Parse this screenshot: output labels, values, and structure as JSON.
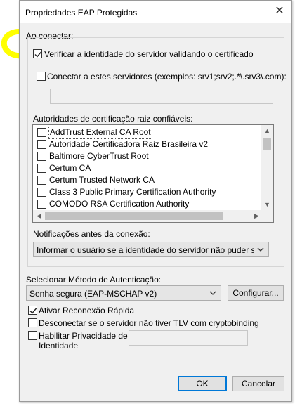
{
  "dialog": {
    "title": "Propriedades EAP Protegidas",
    "close_glyph": "✕"
  },
  "connect_section": {
    "heading": "Ao conectar:",
    "verify_server_label": "Verificar a identidade do servidor validando o certificado",
    "verify_server_checked": true,
    "connect_servers_label": "Conectar a estes servidores (exemplos: srv1;srv2;.*\\.srv3\\.com):",
    "connect_servers_checked": false,
    "servers_value": "",
    "ca_heading": "Autoridades de certificação raiz confiáveis:",
    "ca_items": [
      {
        "label": "AddTrust External CA Root",
        "checked": false
      },
      {
        "label": "Autoridade Certificadora Raiz Brasileira v2",
        "checked": false
      },
      {
        "label": "Baltimore CyberTrust Root",
        "checked": false
      },
      {
        "label": "Certum CA",
        "checked": false
      },
      {
        "label": "Certum Trusted Network CA",
        "checked": false
      },
      {
        "label": "Class 3 Public Primary Certification Authority",
        "checked": false
      },
      {
        "label": "COMODO RSA Certification Authority",
        "checked": false
      }
    ],
    "notifications_heading": "Notificações antes da conexão:",
    "notifications_value": "Informar o usuário se a identidade do servidor não puder ser ver"
  },
  "auth_method": {
    "heading": "Selecionar Método de Autenticação:",
    "value": "Senha segura (EAP-MSCHAP v2)",
    "configure_label": "Configurar..."
  },
  "options": {
    "fast_reconnect_label": "Ativar Reconexão Rápida",
    "fast_reconnect_checked": true,
    "disconnect_label": "Desconectar se o servidor não tiver TLV com cryptobinding",
    "disconnect_checked": false,
    "privacy_label_line1": "Habilitar Privacidade de",
    "privacy_label_line2": "Identidade",
    "privacy_checked": false,
    "identity_value": ""
  },
  "buttons": {
    "ok_label": "OK",
    "cancel_label": "Cancelar"
  },
  "colors": {
    "highlight": "#ffff00",
    "accent": "#0078d7"
  }
}
